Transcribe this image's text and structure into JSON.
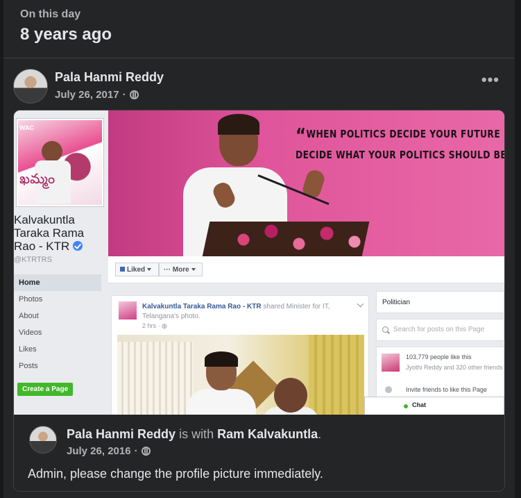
{
  "memory": {
    "label": "On this day",
    "years_ago": "8 years ago"
  },
  "post": {
    "author": "Pala Hanmi Reddy",
    "date": "July 26, 2017",
    "separator": "·",
    "privacy_icon": "globe-icon",
    "more_icon": "more-horizontal-icon",
    "more_label": "•••"
  },
  "fb_page": {
    "page_name_line1": "Kalvakuntla",
    "page_name_line2": "Taraka Rama",
    "page_name_line3": "Rao - KTR",
    "handle": "@KTRTRS",
    "nav": [
      "Home",
      "Photos",
      "About",
      "Videos",
      "Likes",
      "Posts"
    ],
    "create_page": "Create a Page",
    "profile_sign_text": "WAC",
    "profile_scrawl_text": "ఖమ్మం",
    "cover_quote_line1": "WHEN POLITICS DECIDE YOUR FUTURE",
    "cover_quote_line2": "DECIDE WHAT YOUR POLITICS SHOULD BE",
    "quote_open": "“",
    "quote_close": "”",
    "liked_button": "Liked",
    "more_button": "More",
    "feed_author": "Kalvakuntla Taraka Rama Rao - KTR",
    "feed_action": "shared Minister for IT, Telangana's photo.",
    "feed_time": "2 hrs · ",
    "category": "Politician",
    "search_placeholder": "Search for posts on this Page",
    "likes_count": "103,779 people like this",
    "likes_friends": "Jyothi Reddy and 320 other friends",
    "invite_text": "Invite friends to like this Page",
    "chat_label": "Chat"
  },
  "shared": {
    "author": "Pala Hanmi Reddy",
    "with_text": " is with ",
    "tagged": "Ram Kalvakuntla",
    "period": ".",
    "date": "July 26, 2016",
    "separator": "·",
    "privacy_icon": "globe-icon",
    "message": "Admin, please change the profile picture immediately."
  },
  "colors": {
    "background": "#18191a",
    "card": "#242526",
    "primary_text": "#e4e6eb",
    "secondary_text": "#b0b3b8",
    "fb_blue": "#4267b2",
    "cover_pink": "#e0559b",
    "create_green": "#42b72a"
  }
}
